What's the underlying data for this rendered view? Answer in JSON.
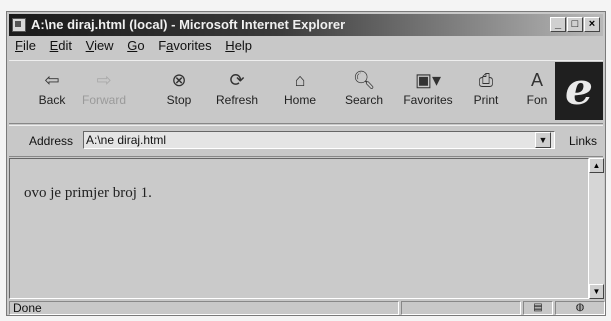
{
  "window": {
    "title": "A:\\ne diraj.html (local) - Microsoft Internet Explorer"
  },
  "menu": [
    {
      "key": "F",
      "rest": "ile"
    },
    {
      "key": "E",
      "rest": "dit"
    },
    {
      "key": "V",
      "rest": "iew"
    },
    {
      "key": "G",
      "rest": "o"
    },
    {
      "pre": "F",
      "key": "a",
      "rest": "vorites"
    },
    {
      "key": "H",
      "rest": "elp"
    }
  ],
  "toolbar": {
    "back": "Back",
    "forward": "Forward",
    "stop": "Stop",
    "refresh": "Refresh",
    "home": "Home",
    "search": "Search",
    "favorites": "Favorites",
    "print": "Print",
    "font": "Fon"
  },
  "address": {
    "label": "Address",
    "value": "A:\\ne diraj.html",
    "links": "Links"
  },
  "page": {
    "text": "ovo je primjer broj 1."
  },
  "status": {
    "text": "Done"
  }
}
